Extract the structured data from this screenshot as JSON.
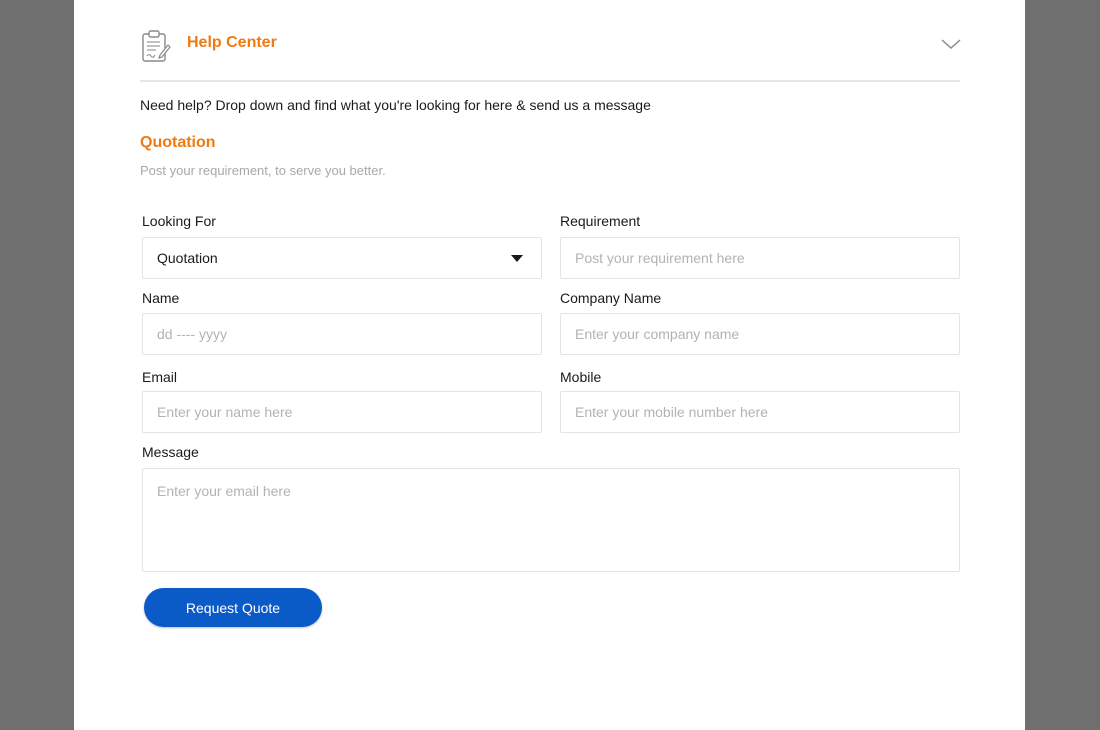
{
  "colors": {
    "accent": "#f07a12",
    "primary_button": "#0a5bc7",
    "backdrop": "#6f6f6f"
  },
  "header": {
    "title": "Help Center",
    "icon": "clipboard-icon",
    "toggle_icon": "chevron-down-icon"
  },
  "intro": "Need help? Drop down and find what you're looking for here & send us a message",
  "section": {
    "title": "Quotation",
    "subtitle": "Post your requirement, to serve you better."
  },
  "form": {
    "looking_for": {
      "label": "Looking For",
      "value": "Quotation"
    },
    "requirement": {
      "label": "Requirement",
      "placeholder": "Post your requirement here"
    },
    "name": {
      "label": "Name",
      "placeholder": "dd ---- yyyy"
    },
    "company_name": {
      "label": "Company Name",
      "placeholder": "Enter your company name"
    },
    "email": {
      "label": "Email",
      "placeholder": "Enter your name here"
    },
    "mobile": {
      "label": "Mobile",
      "placeholder": "Enter your mobile number here"
    },
    "message": {
      "label": "Message",
      "placeholder": "Enter your email here"
    },
    "submit_label": "Request Quote"
  }
}
